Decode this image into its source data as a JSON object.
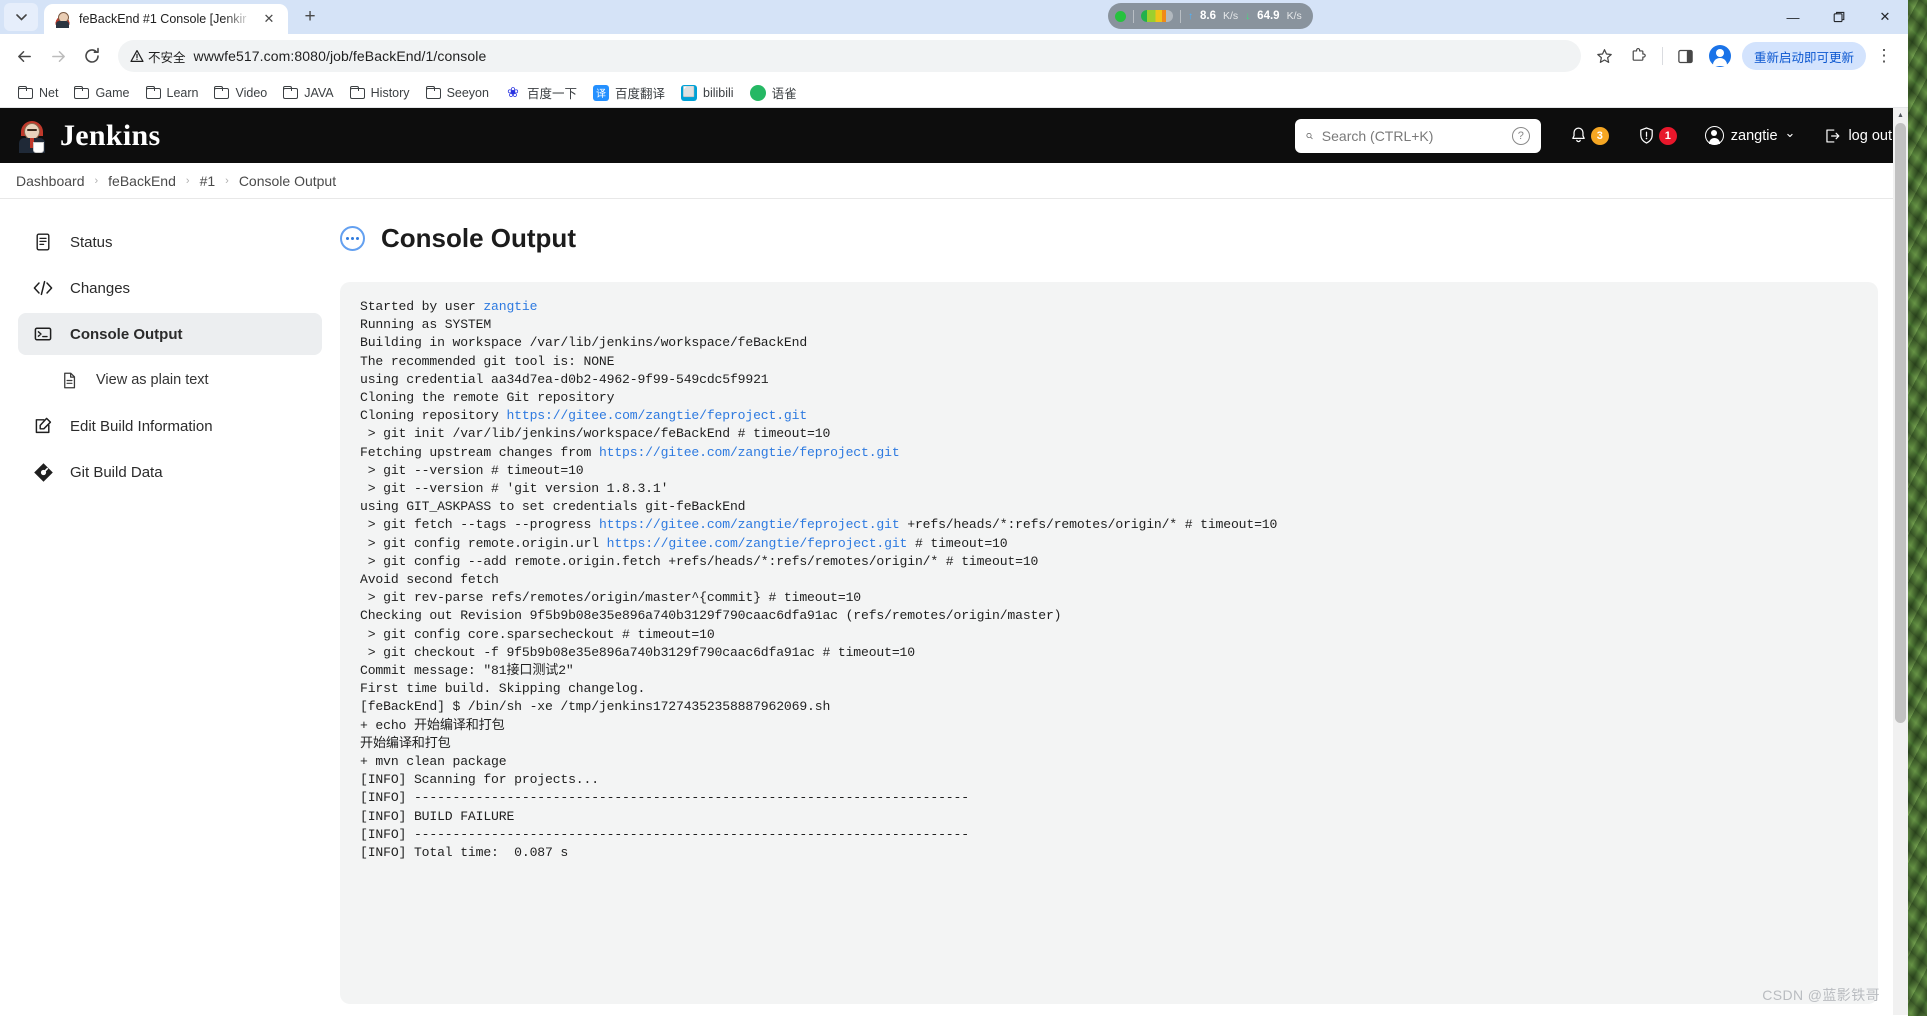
{
  "browser": {
    "tab": {
      "title": "feBackEnd #1 Console [Jenkir",
      "favicon": "jenkins-favicon",
      "close_label": "✕",
      "new_tab_label": "+",
      "tab_list_label": "⌄"
    },
    "toolbar": {
      "back_label": "←",
      "forward_label": "→",
      "reload_label": "⟳",
      "security_label": "不安全",
      "security_icon": "warning-triangle-icon",
      "url": "wwwfe517.com:8080/job/feBackEnd/1/console",
      "bookmark_star_label": "☆",
      "extensions_label": "extensions-puzzle-icon",
      "sidepanel_label": "side-panel-icon",
      "profile_label": "profile-avatar",
      "update_button": "重新启动即可更新",
      "menu_label": "⋮"
    },
    "bookmarks": [
      {
        "label": "Net",
        "icon": "folder-icon"
      },
      {
        "label": "Game",
        "icon": "folder-icon"
      },
      {
        "label": "Learn",
        "icon": "folder-icon"
      },
      {
        "label": "Video",
        "icon": "folder-icon"
      },
      {
        "label": "JAVA",
        "icon": "folder-icon"
      },
      {
        "label": "History",
        "icon": "folder-icon"
      },
      {
        "label": "Seeyon",
        "icon": "folder-icon"
      },
      {
        "label": "百度一下",
        "icon": "baidu-paw-icon",
        "color": "#2932e1",
        "glyph": "❀"
      },
      {
        "label": "百度翻译",
        "icon": "baidu-fanyi-icon",
        "color": "#2490ff",
        "glyph": "译"
      },
      {
        "label": "bilibili",
        "icon": "bilibili-icon",
        "color": "#00a1d6",
        "glyph": "⬜"
      },
      {
        "label": "语雀",
        "icon": "yuque-icon",
        "color": "#25b864",
        "glyph": "●"
      }
    ],
    "window_controls": {
      "minimize": "—",
      "maximize": "❐",
      "close": "✕"
    },
    "netspeed_widget": {
      "upload_value": "8.6",
      "upload_unit": "K/s",
      "upload_arrow": "↑",
      "download_value": "64.9",
      "download_unit": "K/s",
      "download_arrow": "↓"
    },
    "scrollbar": {
      "up_arrow": "▲",
      "down_arrow": "▼"
    }
  },
  "jenkins": {
    "brand": "Jenkins",
    "search": {
      "placeholder": "Search (CTRL+K)",
      "value": "",
      "help_label": "?"
    },
    "header_actions": {
      "notifications_count": "3",
      "notifications_color": "#f5a623",
      "security_count": "1",
      "security_color": "#e8172b",
      "user_name": "zangtie",
      "user_caret": "⌄",
      "logout_label": "log out"
    },
    "breadcrumb": {
      "separator": "›",
      "items": [
        "Dashboard",
        "feBackEnd",
        "#1",
        "Console Output"
      ]
    },
    "sidebar": [
      {
        "label": "Status",
        "icon": "document-icon",
        "active": false,
        "sub": false
      },
      {
        "label": "Changes",
        "icon": "code-icon",
        "active": false,
        "sub": false
      },
      {
        "label": "Console Output",
        "icon": "terminal-icon",
        "active": true,
        "sub": false
      },
      {
        "label": "View as plain text",
        "icon": "page-icon",
        "active": false,
        "sub": true
      },
      {
        "label": "Edit Build Information",
        "icon": "edit-icon",
        "active": false,
        "sub": false
      },
      {
        "label": "Git Build Data",
        "icon": "git-icon",
        "active": false,
        "sub": false
      }
    ],
    "main": {
      "title": "Console Output",
      "title_icon": "in-progress-icon"
    },
    "console": {
      "link_color": "#2e7ae0",
      "lines": [
        [
          {
            "t": "Started by user "
          },
          {
            "t": "zangtie",
            "link": true
          }
        ],
        [
          {
            "t": "Running as SYSTEM"
          }
        ],
        [
          {
            "t": "Building in workspace /var/lib/jenkins/workspace/feBackEnd"
          }
        ],
        [
          {
            "t": "The recommended git tool is: NONE"
          }
        ],
        [
          {
            "t": "using credential aa34d7ea-d0b2-4962-9f99-549cdc5f9921"
          }
        ],
        [
          {
            "t": "Cloning the remote Git repository"
          }
        ],
        [
          {
            "t": "Cloning repository "
          },
          {
            "t": "https://gitee.com/zangtie/feproject.git",
            "link": true
          }
        ],
        [
          {
            "t": " > git init /var/lib/jenkins/workspace/feBackEnd # timeout=10"
          }
        ],
        [
          {
            "t": "Fetching upstream changes from "
          },
          {
            "t": "https://gitee.com/zangtie/feproject.git",
            "link": true
          }
        ],
        [
          {
            "t": " > git --version # timeout=10"
          }
        ],
        [
          {
            "t": " > git --version # 'git version 1.8.3.1'"
          }
        ],
        [
          {
            "t": "using GIT_ASKPASS to set credentials git-feBackEnd"
          }
        ],
        [
          {
            "t": " > git fetch --tags --progress "
          },
          {
            "t": "https://gitee.com/zangtie/feproject.git",
            "link": true
          },
          {
            "t": " +refs/heads/*:refs/remotes/origin/* # timeout=10"
          }
        ],
        [
          {
            "t": " > git config remote.origin.url "
          },
          {
            "t": "https://gitee.com/zangtie/feproject.git",
            "link": true
          },
          {
            "t": " # timeout=10"
          }
        ],
        [
          {
            "t": " > git config --add remote.origin.fetch +refs/heads/*:refs/remotes/origin/* # timeout=10"
          }
        ],
        [
          {
            "t": "Avoid second fetch"
          }
        ],
        [
          {
            "t": " > git rev-parse refs/remotes/origin/master^{commit} # timeout=10"
          }
        ],
        [
          {
            "t": "Checking out Revision 9f5b9b08e35e896a740b3129f790caac6dfa91ac (refs/remotes/origin/master)"
          }
        ],
        [
          {
            "t": " > git config core.sparsecheckout # timeout=10"
          }
        ],
        [
          {
            "t": " > git checkout -f 9f5b9b08e35e896a740b3129f790caac6dfa91ac # timeout=10"
          }
        ],
        [
          {
            "t": "Commit message: \"81接口测试2\""
          }
        ],
        [
          {
            "t": "First time build. Skipping changelog."
          }
        ],
        [
          {
            "t": "[feBackEnd] $ /bin/sh -xe /tmp/jenkins17274352358887962069.sh"
          }
        ],
        [
          {
            "t": "+ echo 开始编译和打包"
          }
        ],
        [
          {
            "t": "开始编译和打包"
          }
        ],
        [
          {
            "t": "+ mvn clean package"
          }
        ],
        [
          {
            "t": "[INFO] Scanning for projects..."
          }
        ],
        [
          {
            "t": "[INFO] ------------------------------------------------------------------------"
          }
        ],
        [
          {
            "t": "[INFO] BUILD FAILURE"
          }
        ],
        [
          {
            "t": "[INFO] ------------------------------------------------------------------------"
          }
        ],
        [
          {
            "t": "[INFO] Total time:  0.087 s"
          }
        ]
      ]
    }
  },
  "watermark": "CSDN @蓝影铁哥"
}
